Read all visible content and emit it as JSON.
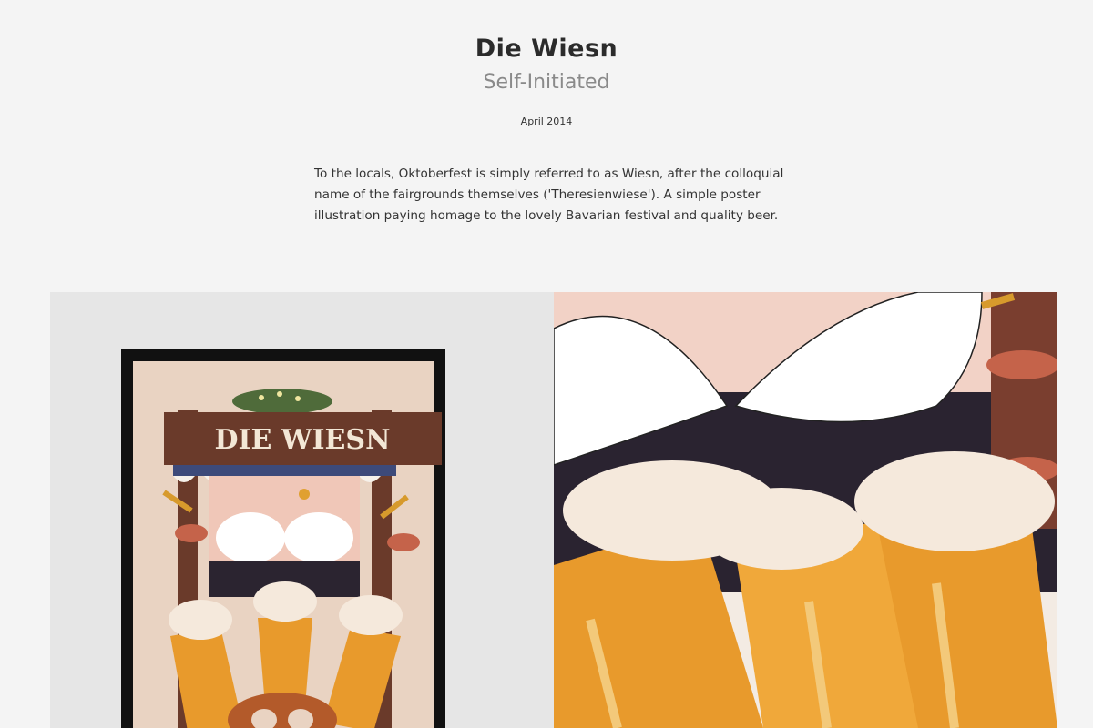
{
  "project": {
    "title": "Die Wiesn",
    "category": "Self-Initiated",
    "date": "April 2014",
    "description": "To the locals, Oktoberfest is simply referred to as Wiesn, after the colloquial name of the fairgrounds themselves ('Theresienwiese'). A simple poster illustration paying homage to the lovely Bavarian festival and quality beer."
  },
  "artwork": {
    "poster_sign_text": "DIE WIESN",
    "colors": {
      "beer": "#e89a2c",
      "foam": "#f5e9dc",
      "wood": "#6a3a2a",
      "leaf": "#c5634a",
      "frame": "#111111"
    }
  }
}
